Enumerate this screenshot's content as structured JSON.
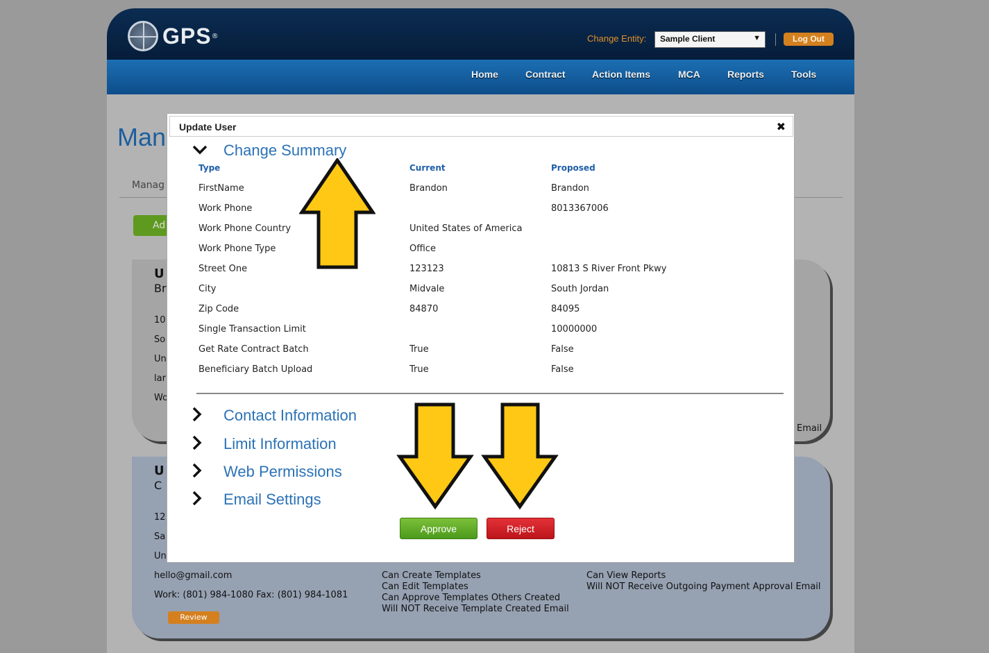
{
  "header": {
    "logo_text": "GPS",
    "logo_reg": "®",
    "change_entity_label": "Change Entity:",
    "entity_selected": "Sample Client",
    "logout_label": "Log Out"
  },
  "nav": {
    "items": [
      "Home",
      "Contract",
      "Action Items",
      "MCA",
      "Reports",
      "Tools"
    ]
  },
  "background": {
    "page_title": "Mana",
    "tab_label": "Manag",
    "add_button": "Ad",
    "card1": {
      "title": "U",
      "subtitle": "Br",
      "lines": [
        "10",
        "So",
        "Un",
        "lar",
        "Wo"
      ],
      "email_right": "Email"
    },
    "card2": {
      "title": "U",
      "subtitle": "C",
      "lines": [
        "12",
        "Sa",
        "Un"
      ],
      "email": "hello@gmail.com",
      "phones": "Work: (801) 984-1080  Fax: (801) 984-1081",
      "templates_perms": [
        "Can Create Templates",
        "Can Edit Templates",
        "Can Approve Templates Others Created",
        "Will NOT Receive Template Created Email"
      ],
      "other_perms": [
        "Can View Reports",
        "Will NOT Receive Outgoing Payment Approval Email"
      ],
      "review_label": "Review"
    }
  },
  "modal": {
    "title": "Update User",
    "close_symbol": "✖",
    "change_summary": {
      "label": "Change Summary",
      "columns": [
        "Type",
        "Current",
        "Proposed"
      ],
      "rows": [
        [
          "FirstName",
          "Brandon",
          "Brandon"
        ],
        [
          "Work Phone",
          "",
          "8013367006"
        ],
        [
          "Work Phone Country",
          "United States of America",
          ""
        ],
        [
          "Work Phone Type",
          "Office",
          ""
        ],
        [
          "Street One",
          "123123",
          "10813 S River Front Pkwy"
        ],
        [
          "City",
          "Midvale",
          "South Jordan"
        ],
        [
          "Zip Code",
          "84870",
          "84095"
        ],
        [
          "Single Transaction Limit",
          "",
          "10000000"
        ],
        [
          "Get Rate Contract Batch",
          "True",
          "False"
        ],
        [
          "Beneficiary Batch Upload",
          "True",
          "False"
        ]
      ]
    },
    "sections": [
      "Contact Information",
      "Limit Information",
      "Web Permissions",
      "Email Settings"
    ],
    "approve_label": "Approve",
    "reject_label": "Reject"
  },
  "colors": {
    "accent_blue": "#2b72b6",
    "arrow_fill": "#ffc814",
    "approve_green": "#5fa82a",
    "reject_red": "#d21f25"
  }
}
